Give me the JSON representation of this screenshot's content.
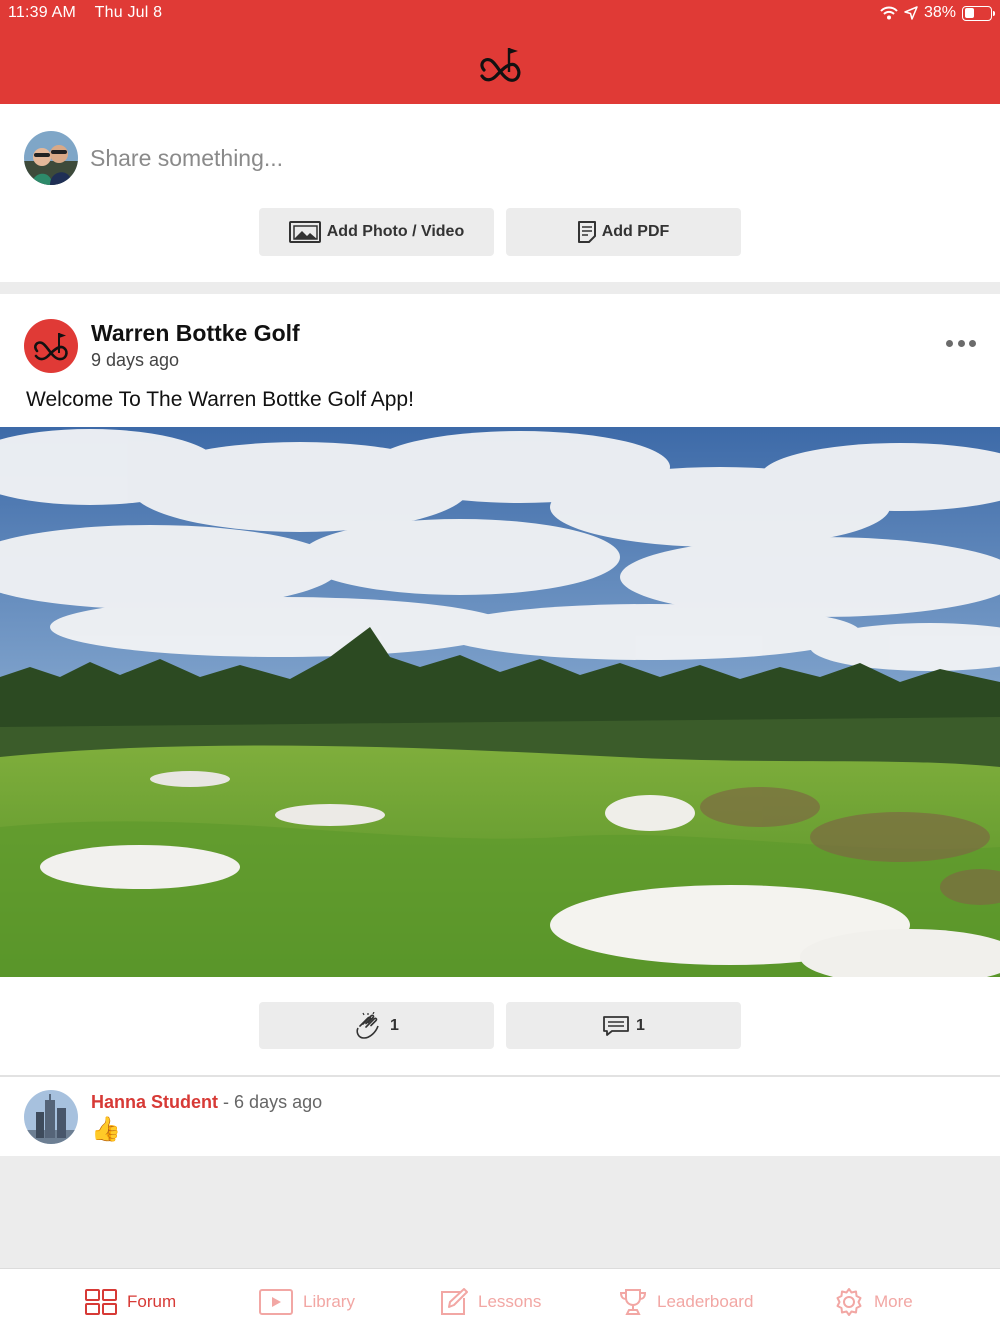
{
  "status_bar": {
    "time": "11:39 AM",
    "date": "Thu Jul 8",
    "battery": "38%",
    "battery_level": 0.38,
    "icons": [
      "wifi-icon",
      "location-arrow-icon",
      "battery-icon"
    ]
  },
  "header": {
    "logo": "golf-flag-heart-logo"
  },
  "composer": {
    "placeholder": "Share something...",
    "add_media_label": "Add Photo / Video",
    "add_pdf_label": "Add PDF"
  },
  "post": {
    "author": "Warren Bottke Golf",
    "time": "9 days ago",
    "text": "Welcome To The Warren Bottke Golf App!",
    "image": "golf-course-photo",
    "claps": "1",
    "comments": "1"
  },
  "comment": {
    "author": "Hanna Student",
    "separator": "-",
    "time": "6 days ago",
    "body": "👍"
  },
  "tabs": [
    {
      "label": "Forum",
      "icon": "grid-icon",
      "active": true
    },
    {
      "label": "Library",
      "icon": "play-icon",
      "active": false
    },
    {
      "label": "Lessons",
      "icon": "edit-icon",
      "active": false
    },
    {
      "label": "Leaderboard",
      "icon": "trophy-icon",
      "active": false
    },
    {
      "label": "More",
      "icon": "gear-icon",
      "active": false
    }
  ],
  "colors": {
    "brand_red": "#e03a36",
    "tab_active": "#d73a36",
    "tab_inactive": "#f2a7a4",
    "button_bg": "#ececec"
  }
}
